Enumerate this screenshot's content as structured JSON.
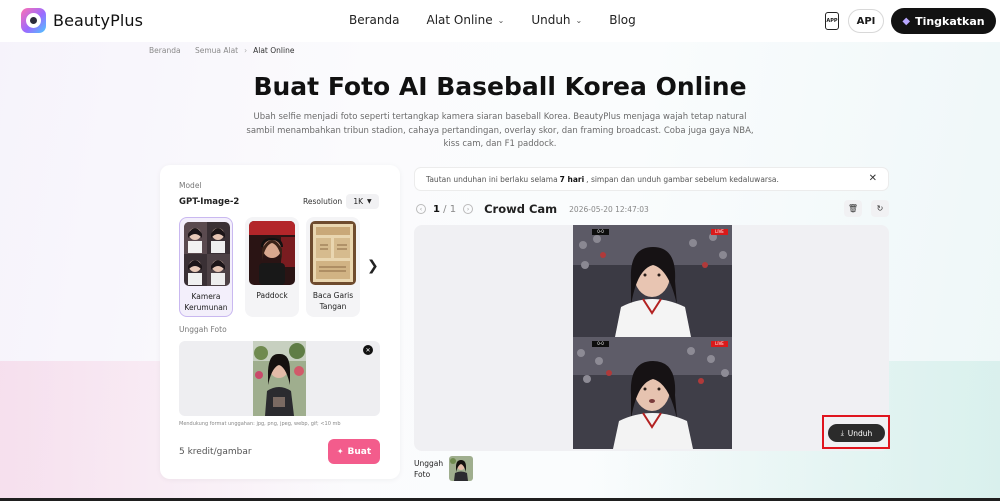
{
  "header": {
    "brand": "BeautyPlus",
    "nav": [
      {
        "label": "Beranda"
      },
      {
        "label": "Alat Online"
      },
      {
        "label": "Unduh"
      },
      {
        "label": "Blog"
      }
    ],
    "app_label": "APP",
    "api_label": "API",
    "upgrade_label": "Tingkatkan"
  },
  "breadcrumb": [
    "Beranda",
    "Semua Alat",
    "Alat Online"
  ],
  "page": {
    "title": "Buat Foto AI Baseball Korea Online",
    "subtitle": "Ubah selfie menjadi foto seperti tertangkap kamera siaran baseball Korea. BeautyPlus menjaga wajah tetap natural sambil menambahkan tribun stadion, cahaya pertandingan, overlay skor, dan framing broadcast. Coba juga gaya NBA, kiss cam, dan F1 paddock."
  },
  "generator": {
    "model_label": "Model",
    "model_name": "GPT-Image-2",
    "resolution_label": "Resolution",
    "resolution_value": "1K",
    "styles": [
      {
        "label": "Kamera Kerumunan"
      },
      {
        "label": "Paddock"
      },
      {
        "label": "Baca Garis Tangan"
      }
    ],
    "upload_label": "Unggah Foto",
    "format_note": "Mendukung format unggahan: jpg, png, jpeg, webp, gif; <10 mb",
    "credit": "5 kredit/gambar",
    "create_label": "Buat"
  },
  "result": {
    "notice_before": "Tautan unduhan ini berlaku selama",
    "notice_bold": "7 hari",
    "notice_after": ", simpan dan unduh gambar sebelum kedaluwarsa.",
    "page_current": "1",
    "page_sep": "/",
    "page_total": "1",
    "name": "Crowd Cam",
    "timestamp": "2026-05-20  12:47:03",
    "score_label": "0-0",
    "live_label": "LIVE",
    "download_label": "Unduh",
    "upload_tag": "Unggah Foto"
  },
  "colors": {
    "accent_pink": "#f35c8c",
    "highlight_red": "#e0141e",
    "dark_button": "#121212"
  }
}
